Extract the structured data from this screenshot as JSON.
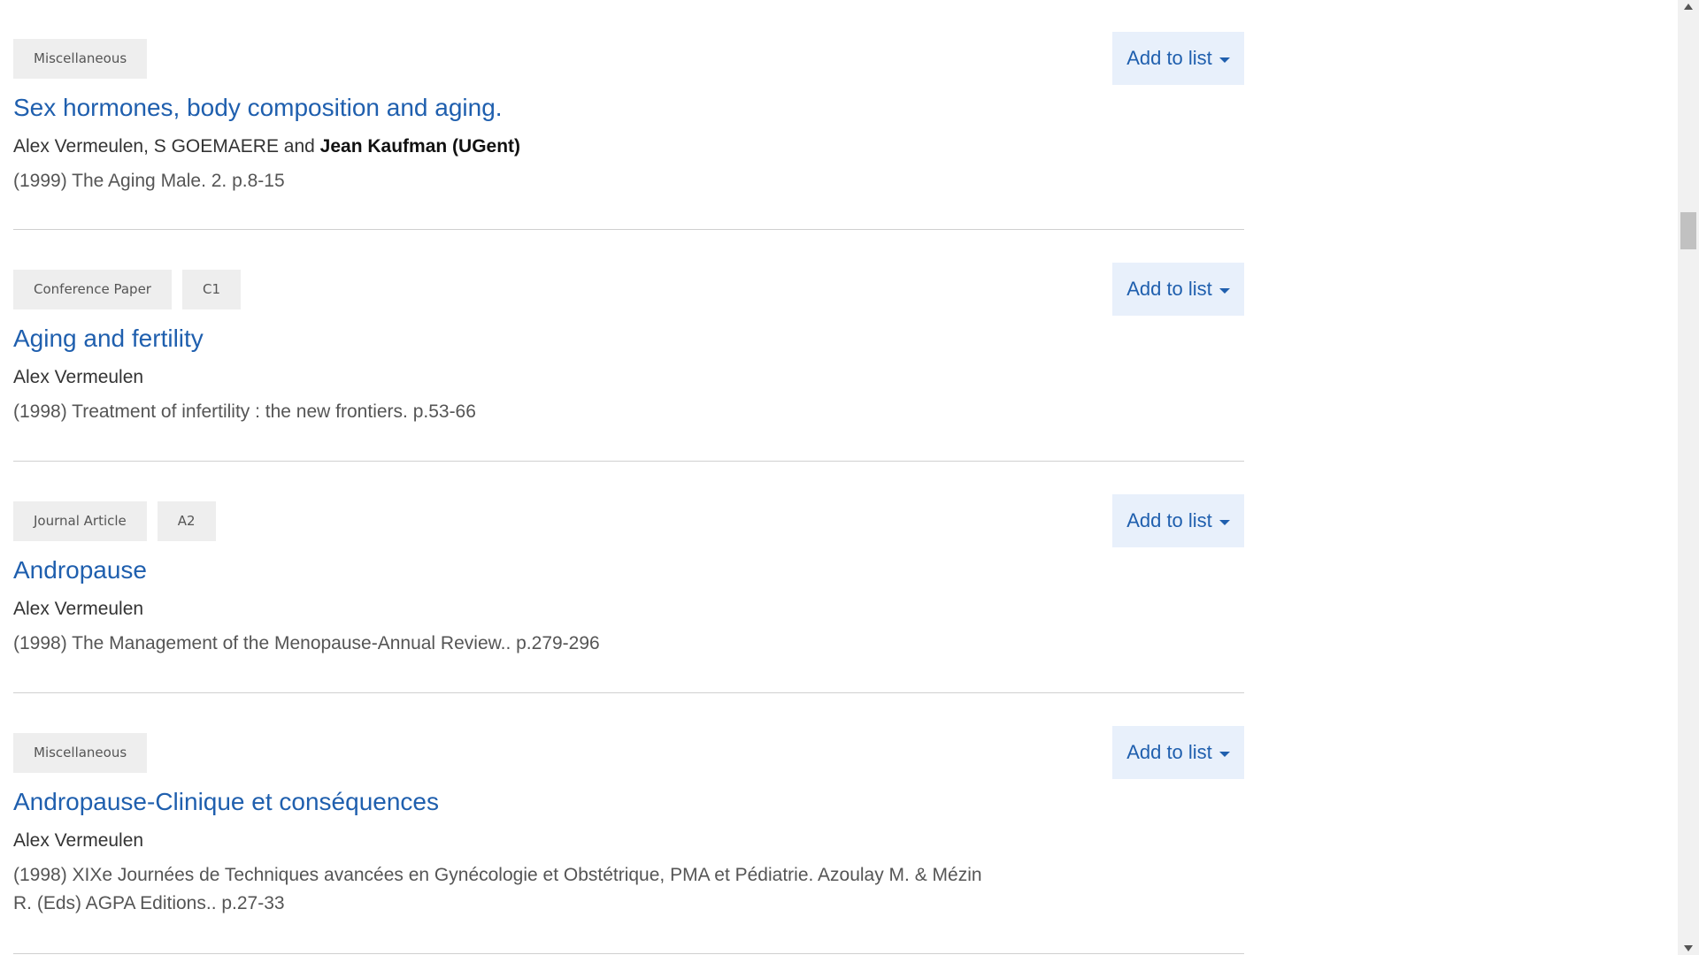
{
  "records": [
    {
      "tags": [
        "Miscellaneous"
      ],
      "add_label": "Add to list",
      "title": "Sex hormones, body composition and aging.",
      "authors_plain": "Alex Vermeulen, S GOEMAERE and ",
      "authors_ugent": "Jean Kaufman (UGent)",
      "source": "(1999) The Aging Male. 2. p.8-15"
    },
    {
      "tags": [
        "Conference Paper",
        "C1"
      ],
      "add_label": "Add to list",
      "title": "Aging and fertility",
      "authors_plain": "Alex Vermeulen",
      "authors_ugent": "",
      "source": "(1998) Treatment of infertility : the new frontiers. p.53-66"
    },
    {
      "tags": [
        "Journal Article",
        "A2"
      ],
      "add_label": "Add to list",
      "title": "Andropause",
      "authors_plain": "Alex Vermeulen",
      "authors_ugent": "",
      "source": "(1998) The Management of the Menopause-Annual Review.. p.279-296"
    },
    {
      "tags": [
        "Miscellaneous"
      ],
      "add_label": "Add to list",
      "title": "Andropause-Clinique et conséquences",
      "authors_plain": "Alex Vermeulen",
      "authors_ugent": "",
      "source": "(1998) XIXe Journées de Techniques avancées en Gynécologie et Obstétrique, PMA et Pédiatrie. Azoulay M. & Mézin R. (Eds) AGPA Editions.. p.27-33"
    }
  ],
  "colors": {
    "link": "#1f5fae",
    "button_bg": "#e8f0fb",
    "tag_bg": "#eeeeee",
    "divider": "#d0d0d0"
  },
  "icons": {
    "dropdown": "caret-down-icon",
    "scroll_up": "arrow-up-icon",
    "scroll_down": "arrow-down-icon"
  }
}
